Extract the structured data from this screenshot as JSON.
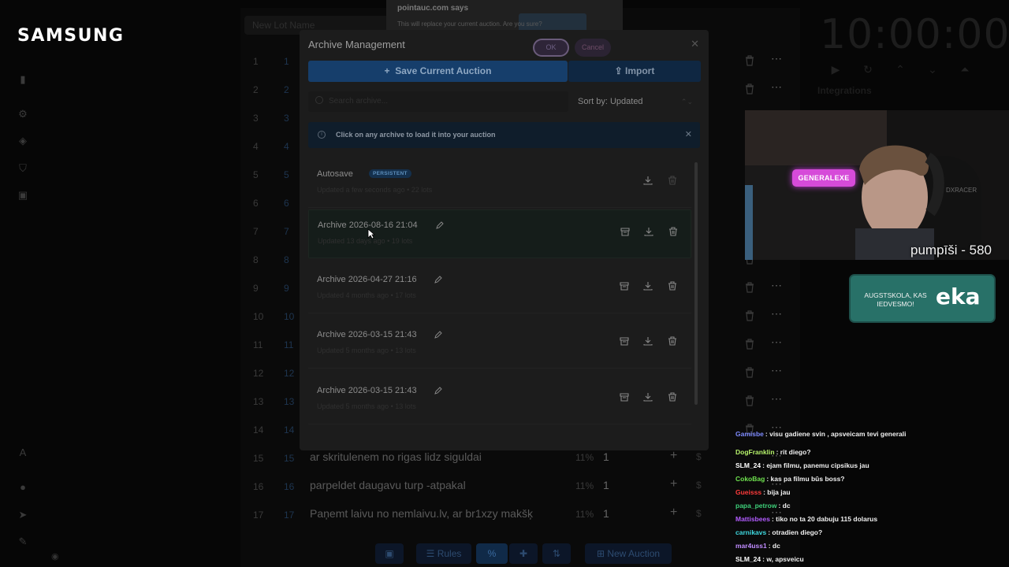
{
  "branding": {
    "logo": "SAMSUNG"
  },
  "background": {
    "top_input_placeholder": "New Lot Name",
    "rows": [
      {
        "num": "1",
        "id": "1",
        "title": ""
      },
      {
        "num": "2",
        "id": "2",
        "title": ""
      },
      {
        "num": "3",
        "id": "3",
        "title": ""
      },
      {
        "num": "4",
        "id": "4",
        "title": ""
      },
      {
        "num": "5",
        "id": "5",
        "title": ""
      },
      {
        "num": "6",
        "id": "6",
        "title": ""
      },
      {
        "num": "7",
        "id": "7",
        "title": ""
      },
      {
        "num": "8",
        "id": "8",
        "title": ""
      },
      {
        "num": "9",
        "id": "9",
        "title": ""
      },
      {
        "num": "10",
        "id": "10",
        "title": ""
      },
      {
        "num": "11",
        "id": "11",
        "title": ""
      },
      {
        "num": "12",
        "id": "12",
        "title": ""
      },
      {
        "num": "13",
        "id": "13",
        "title": ""
      },
      {
        "num": "14",
        "id": "14",
        "title": ""
      },
      {
        "num": "15",
        "id": "15",
        "title": "ar skritulenem no rigas lidz siguldai",
        "pct": "11%",
        "amount": "1",
        "dollar": "$"
      },
      {
        "num": "16",
        "id": "16",
        "title": "parpeldet daugavu turp -atpakal",
        "pct": "11%",
        "amount": "1",
        "dollar": "$"
      },
      {
        "num": "17",
        "id": "17",
        "title": "Paņemt laivu no nemlaivu.lv, ar br1xzy makšķ",
        "pct": "11%",
        "amount": "1",
        "dollar": "$"
      }
    ],
    "bottom_bar": {
      "rules": "Rules",
      "new_auction": "New Auction"
    },
    "timer": "10:00:00",
    "integrations": "Integrations"
  },
  "alert": {
    "site": "pointauc.com says",
    "message": "This will replace your current auction. Are you sure?",
    "ok": "OK",
    "cancel": "Cancel"
  },
  "modal": {
    "title": "Archive Management",
    "save_label": "Save Current Auction",
    "import_label": "Import",
    "search_placeholder": "Search archive...",
    "sort_label": "Sort by: Updated",
    "info_text": "Click on any archive to load it into your auction",
    "archives": [
      {
        "name": "Autosave",
        "badge": "PERSISTENT",
        "sub": "Updated a few seconds ago • 22 lots"
      },
      {
        "name": "Archive 2026-08-16 21:04",
        "sub": "Updated 13 days ago • 19 lots"
      },
      {
        "name": "Archive 2026-04-27 21:16",
        "sub": "Updated 4 months ago • 17 lots"
      },
      {
        "name": "Archive 2026-03-15 21:43",
        "sub": "Updated 5 months ago • 13 lots"
      },
      {
        "name": "Archive 2026-03-15 21:43",
        "sub": "Updated 5 months ago • 13 lots"
      }
    ]
  },
  "stream": {
    "webcam_name": "GENERALEXE",
    "points_text": "pumpīši - 580",
    "ad_small": "AUGSTSKOLA, KAS IEDVESMO!",
    "ad_big": "eka",
    "chat": [
      {
        "user": "Gamisbe",
        "color": "#7e8bff",
        "text": ": visu gadiene svin , apsveicam tevi generali"
      },
      {
        "user": "DogFranklin",
        "color": "#b6f26b",
        "text": ": rit diego?"
      },
      {
        "user": "SLM_24",
        "color": "#ffffff",
        "text": ": ejam filmu, panemu cipsikus jau"
      },
      {
        "user": "CokoBag",
        "color": "#6fe34f",
        "text": ": kas pa filmu būs boss?"
      },
      {
        "user": "Gueisss",
        "color": "#ff3b3b",
        "text": ": bija jau"
      },
      {
        "user": "papa_petrow",
        "color": "#3ed07a",
        "text": ": dc"
      },
      {
        "user": "Mattisbees",
        "color": "#b25cff",
        "text": ": tiko no ta 20 dabuju 115 dolarus"
      },
      {
        "user": "carnikavs",
        "color": "#3fd9e0",
        "text": ": otradien diego?"
      },
      {
        "user": "mar4uss1",
        "color": "#c08cff",
        "text": ": dc"
      },
      {
        "user": "SLM_24",
        "color": "#ffffff",
        "text": ": w, apsveicu"
      }
    ]
  }
}
